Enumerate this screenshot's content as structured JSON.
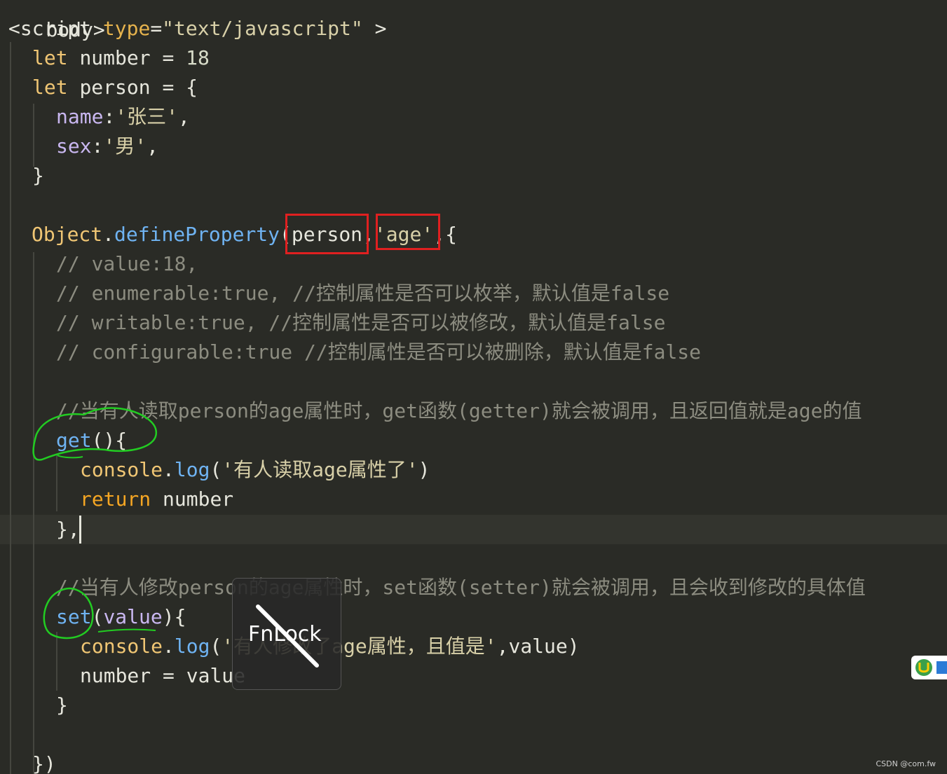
{
  "editor": {
    "top_fragment": "body>",
    "line1": {
      "open": "<script",
      "attr_name": "type",
      "eq": "=",
      "attr_value": "\"text/javascript\"",
      "close": " >"
    },
    "line2": {
      "kw": "let",
      "name": "number",
      "op": " = ",
      "value": "18"
    },
    "line3": {
      "kw": "let",
      "name": "person",
      "op": " = ",
      "brace": "{"
    },
    "line4": {
      "prop": "name",
      "colon": ":",
      "value": "'张三'",
      "comma": ","
    },
    "line5": {
      "prop": "sex",
      "colon": ":",
      "value": "'男'",
      "comma": ","
    },
    "line6": {
      "brace": "}"
    },
    "line7": {
      "obj": "Object",
      "dot": ".",
      "method": "defineProperty",
      "open": "(",
      "arg1": "person",
      "comma1": ",",
      "arg2": "'age'",
      "comma2": ",",
      "brace": "{"
    },
    "comment1": "// value:18,",
    "comment2": "// enumerable:true, //控制属性是否可以枚举，默认值是false",
    "comment3": "// writable:true, //控制属性是否可以被修改，默认值是false",
    "comment4": "// configurable:true //控制属性是否可以被删除，默认值是false",
    "comment5": "//当有人读取person的age属性时，get函数(getter)就会被调用，且返回值就是age的值",
    "get_line": {
      "method": "get",
      "rest": "(){"
    },
    "get_log": {
      "obj": "console",
      "dot": ".",
      "method": "log",
      "open": "(",
      "str": "'有人读取age属性了'",
      "close": ")"
    },
    "get_return": {
      "kw": "return",
      "value": " number"
    },
    "get_close": "},",
    "comment6": "//当有人修改person的age属性时，set函数(setter)就会被调用，且会收到修改的具体值",
    "set_line": {
      "method": "set",
      "open": "(",
      "param": "value",
      "rest": "){"
    },
    "set_log": {
      "obj": "console",
      "dot": ".",
      "method": "log",
      "open": "(",
      "str": "'有人修改了age属性，且值是'",
      "rest": ",value)"
    },
    "set_assign": {
      "name": "number",
      "op": " = ",
      "value": "value"
    },
    "set_close": "}",
    "final_close": "})"
  },
  "overlay": {
    "fnlock_label": "FnLock"
  },
  "watermark": "CSDN @com.fw",
  "colors": {
    "background": "#2a2b26",
    "highlight_box": "#e02020",
    "annotation": "#22cc22"
  }
}
